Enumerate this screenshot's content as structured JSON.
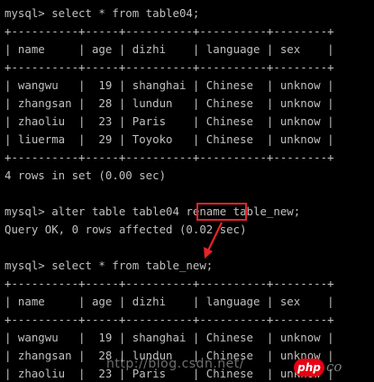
{
  "terminal": {
    "lines": [
      "mysql> select * from table04;",
      "+----------+-----+----------+----------+--------+",
      "| name     | age | dizhi    | language | sex    |",
      "+----------+-----+----------+----------+--------+",
      "| wangwu   |  19 | shanghai | Chinese  | unknow |",
      "| zhangsan |  28 | lundun   | Chinese  | unknow |",
      "| zhaoliu  |  23 | Paris    | Chinese  | unknow |",
      "| liuerma  |  29 | Toyoko   | Chinese  | unknow |",
      "+----------+-----+----------+----------+--------+",
      "4 rows in set (0.00 sec)",
      "",
      "mysql> alter table table04 rename table_new;",
      "Query OK, 0 rows affected (0.02 sec)",
      "",
      "mysql> select * from table_new;",
      "+----------+-----+----------+----------+--------+",
      "| name     | age | dizhi    | language | sex    |",
      "+----------+-----+----------+----------+--------+",
      "| wangwu   |  19 | shanghai | Chinese  | unknow |",
      "| zhangsan |  28 | lundun   | Chinese  | unknow |",
      "| zhaoliu  |  23 | Paris    | Chinese  | unknow |"
    ],
    "highlighted_keyword": "rename"
  },
  "watermark": {
    "url_text": "http://blog.csdn.net/",
    "badge": "php",
    "tail": "co"
  },
  "colors": {
    "background": "#000000",
    "text": "#c0c0c0",
    "highlight_box": "#e8232a",
    "arrow": "#e8232a",
    "badge": "#e60012"
  }
}
